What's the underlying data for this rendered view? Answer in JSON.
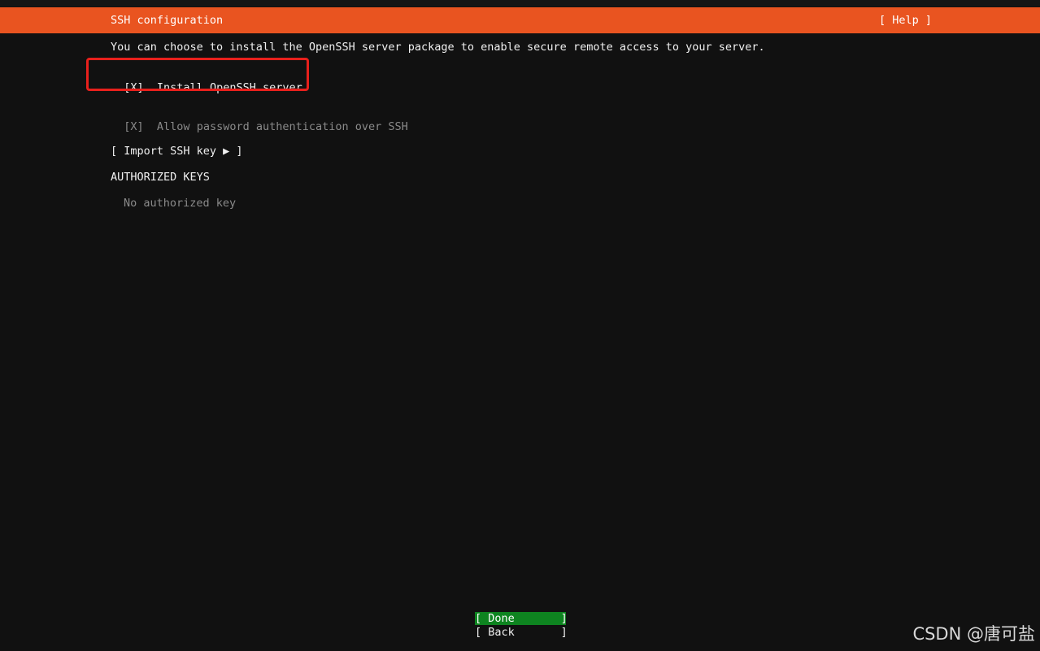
{
  "colors": {
    "background": "#111111",
    "title_bar": "#e95420",
    "done_button": "#0e8420",
    "highlight_box": "#e8201c",
    "dim_text": "#8a8a8a"
  },
  "header": {
    "title": "SSH configuration",
    "help_label": "[ Help ]"
  },
  "main": {
    "description": "You can choose to install the OpenSSH server package to enable secure remote access to your server.",
    "install_openssh": {
      "checkbox": "[X]",
      "label": "Install OpenSSH server",
      "checked": true
    },
    "allow_password": {
      "checkbox": "[X]",
      "label": "Allow password authentication over SSH",
      "checked": true,
      "disabled": true
    },
    "import_key_label": "[ Import SSH key ▶ ]",
    "authorized_keys_heading": "AUTHORIZED KEYS",
    "no_keys_text": "No authorized key"
  },
  "footer": {
    "done_label": "[ Done       ]",
    "back_label": "[ Back       ]"
  },
  "watermark": "CSDN @唐可盐"
}
